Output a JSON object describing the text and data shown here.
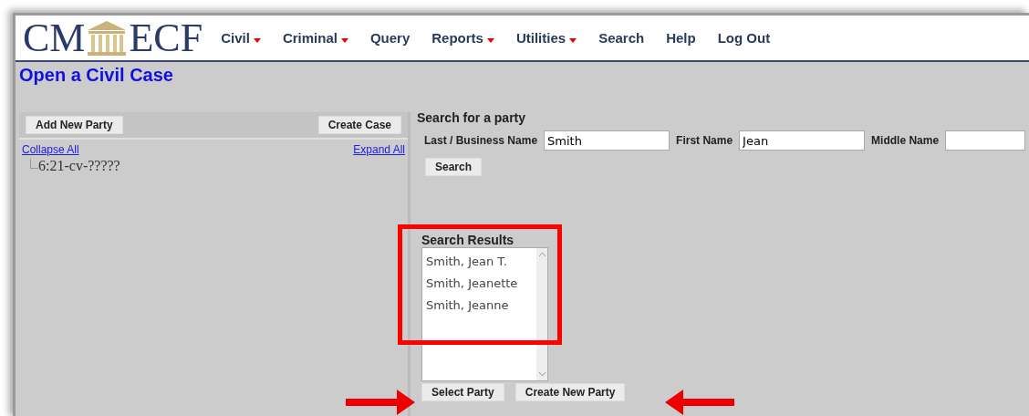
{
  "logo": {
    "left": "CM",
    "right": "ECF"
  },
  "menu": [
    {
      "label": "Civil",
      "dropdown": true
    },
    {
      "label": "Criminal",
      "dropdown": true
    },
    {
      "label": "Query",
      "dropdown": false
    },
    {
      "label": "Reports",
      "dropdown": true
    },
    {
      "label": "Utilities",
      "dropdown": true
    },
    {
      "label": "Search",
      "dropdown": false
    },
    {
      "label": "Help",
      "dropdown": false
    },
    {
      "label": "Log Out",
      "dropdown": false
    }
  ],
  "page_title": "Open a Civil Case",
  "left_panel": {
    "buttons": [
      "Add New Party",
      "Create Case"
    ],
    "links": [
      "Collapse All",
      "Expand All"
    ],
    "tree": [
      {
        "label": "6:21-cv-?????"
      }
    ]
  },
  "search_panel": {
    "heading": "Search for a party",
    "fields": [
      {
        "label": "Last / Business Name",
        "value": "Smith"
      },
      {
        "label": "First Name",
        "value": "Jean"
      },
      {
        "label": "Middle Name"
      }
    ],
    "search_button": "Search",
    "results_label": "Search Results",
    "results": [
      "Smith, Jean T.",
      "Smith, Jeanette",
      "Smith, Jeanne"
    ],
    "buttons": [
      "Select Party",
      "Create New Party"
    ]
  },
  "annotations": {
    "highlight_box": true,
    "arrows": true
  }
}
